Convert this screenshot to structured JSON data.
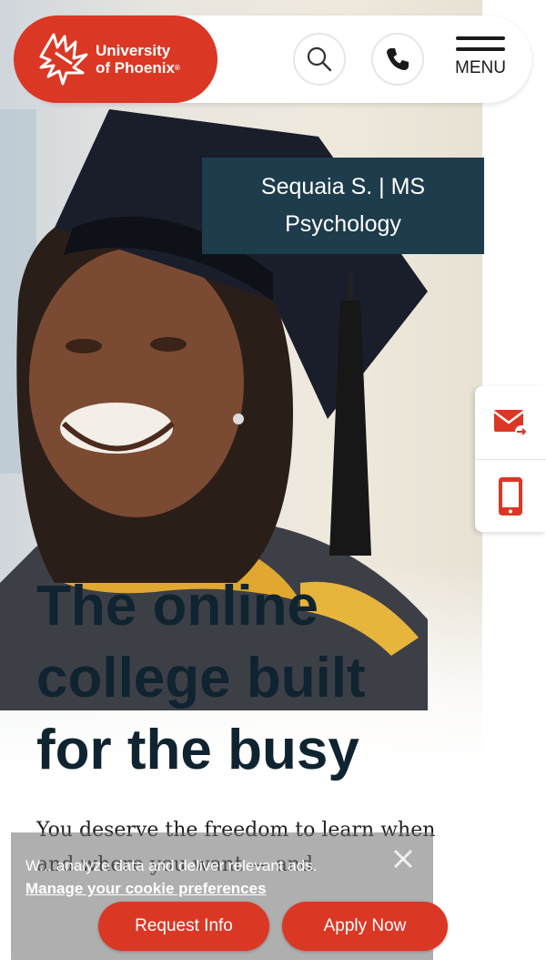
{
  "header": {
    "logo_line1": "University",
    "logo_line2": "of Phoenix",
    "logo_mark": "®",
    "search_icon": "search-icon",
    "phone_icon": "phone-icon",
    "menu_label": "MENU"
  },
  "hero": {
    "caption_line1": "Sequaia S. | MS",
    "caption_line2": "Psychology",
    "headline_line1": "The online",
    "headline_line2": "college built",
    "headline_line3": "for the busy",
    "subcopy": "You deserve the freedom to learn when and where you want — and"
  },
  "side_tabs": {
    "email_icon": "email-icon",
    "mobile_icon": "mobile-phone-icon"
  },
  "cookie_banner": {
    "text": "W... analyze data and deliver relevant ads.",
    "link": "Manage your cookie preferences"
  },
  "cta": {
    "request_info": "Request Info",
    "apply_now": "Apply Now"
  },
  "colors": {
    "brand_red": "#db3725",
    "caption_navy": "#1d3c4c",
    "headline": "#0f2430"
  }
}
